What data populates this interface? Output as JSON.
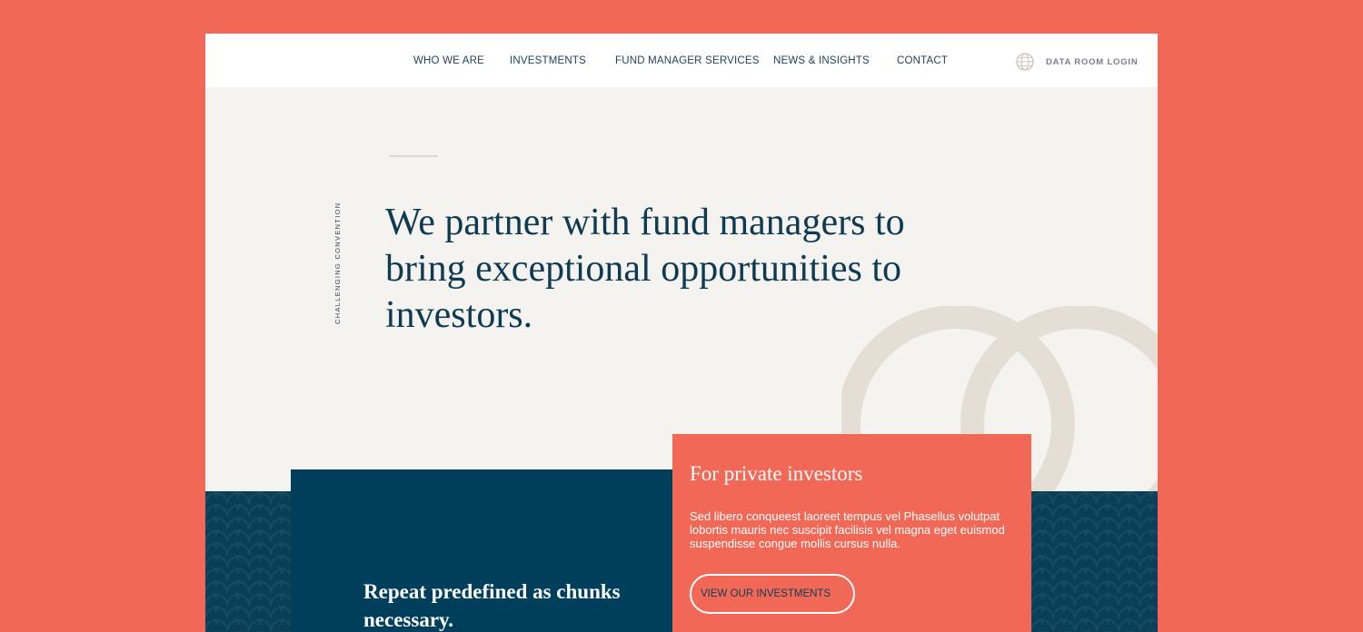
{
  "nav": {
    "items": [
      {
        "label": "WHO WE ARE"
      },
      {
        "label": "INVESTMENTS"
      },
      {
        "label": "FUND MANAGER SERVICES"
      },
      {
        "label": "NEWS & INSIGHTS"
      },
      {
        "label": "CONTACT"
      }
    ],
    "login": {
      "label": "DATA ROOM LOGIN",
      "icon": "globe-icon"
    }
  },
  "hero": {
    "tagline": "CHALLENGING CONVENTION",
    "headline": "We partner with fund managers to bring exceptional opportunities to investors."
  },
  "lower": {
    "dark_card_text": "Repeat predefined as chunks necessary.",
    "private": {
      "title": "For private investors",
      "body": "Sed libero conqueest laoreet tempus vel Phasellus volutpat lobortis mauris nec suscipit facilisis vel magna eget euismod suspendisse congue mollis cursus nulla.",
      "button": "VIEW OUR INVESTMENTS"
    }
  },
  "colors": {
    "accent_coral": "#f26856",
    "navy": "#0b3f58",
    "text_dark": "#0e3a52",
    "hero_bg": "#f5f3f0"
  }
}
